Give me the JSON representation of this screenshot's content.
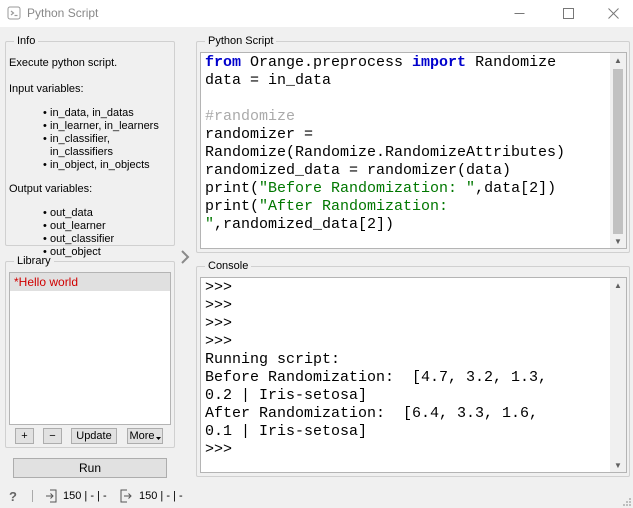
{
  "window": {
    "title": "Python Script",
    "minimize": "—",
    "maximize": "☐",
    "close": "✕"
  },
  "info": {
    "legend": "Info",
    "description": "Execute python script.",
    "input_heading": "Input variables:",
    "inputs": [
      "in_data, in_datas",
      "in_learner, in_learners",
      "in_classifier, in_classifiers",
      "in_object, in_objects"
    ],
    "output_heading": "Output variables:",
    "outputs": [
      "out_data",
      "out_learner",
      "out_classifier",
      "out_object"
    ]
  },
  "library": {
    "legend": "Library",
    "items": [
      "*Hello world"
    ],
    "add_label": "+",
    "remove_label": "−",
    "update_label": "Update",
    "more_label": "More"
  },
  "run_label": "Run",
  "script": {
    "legend": "Python Script",
    "lines": [
      [
        {
          "t": "from",
          "c": "kw"
        },
        {
          "t": " Orange.preprocess ",
          "c": ""
        },
        {
          "t": "import",
          "c": "kw"
        },
        {
          "t": " Randomize",
          "c": ""
        }
      ],
      [
        {
          "t": "data = in_data",
          "c": ""
        }
      ],
      [
        {
          "t": "",
          "c": ""
        }
      ],
      [
        {
          "t": "#randomize",
          "c": "cm"
        }
      ],
      [
        {
          "t": "randomizer =",
          "c": ""
        }
      ],
      [
        {
          "t": "Randomize(Randomize.RandomizeAttributes)",
          "c": ""
        }
      ],
      [
        {
          "t": "randomized_data = randomizer(data)",
          "c": ""
        }
      ],
      [
        {
          "t": "print(",
          "c": ""
        },
        {
          "t": "\"Before Randomization: \"",
          "c": "st"
        },
        {
          "t": ",data[2])",
          "c": ""
        }
      ],
      [
        {
          "t": "print(",
          "c": ""
        },
        {
          "t": "\"After Randomization:",
          "c": "st"
        }
      ],
      [
        {
          "t": "\"",
          "c": "st"
        },
        {
          "t": ",randomized_data[2])",
          "c": ""
        }
      ]
    ]
  },
  "console": {
    "legend": "Console",
    "lines": [
      ">>>",
      ">>>",
      ">>>",
      ">>>",
      "Running script:",
      "Before Randomization:  [4.7, 3.2, 1.3,",
      "0.2 | Iris-setosa]",
      "After Randomization:  [6.4, 3.3, 1.6,",
      "0.1 | Iris-setosa]",
      ">>>"
    ]
  },
  "status": {
    "help": "?",
    "input_summary": "150 | - | -",
    "output_summary": "150 | - | -"
  },
  "icons": {
    "app": "python-script-icon",
    "splitter": "chevron-right-icon",
    "input": "input-arrow-icon",
    "output": "output-arrow-icon"
  }
}
